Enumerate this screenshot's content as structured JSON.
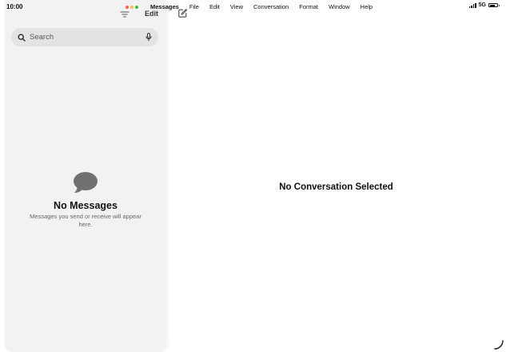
{
  "status_bar": {
    "time": "10:00",
    "network": "5G",
    "signal_icon": "signal-bars-icon",
    "battery_icon": "battery-icon"
  },
  "window_controls": {
    "close_color": "#ff5f57",
    "minimize_color": "#febc2e",
    "zoom_color": "#28c840"
  },
  "menu_bar": {
    "items": [
      "Messages",
      "File",
      "Edit",
      "View",
      "Conversation",
      "Format",
      "Window",
      "Help"
    ]
  },
  "sidebar_toolbar": {
    "filter_icon": "filter-lines-icon",
    "edit_label": "Edit",
    "compose_icon": "compose-icon"
  },
  "search": {
    "placeholder": "Search",
    "value": "",
    "icons": [
      "search-icon",
      "microphone-icon"
    ]
  },
  "empty_state": {
    "icon": "message-bubble-icon",
    "title": "No Messages",
    "subtitle": "Messages you send or receive will appear here."
  },
  "detail": {
    "placeholder": "No Conversation Selected"
  },
  "colors": {
    "sidebar_bg": "#f2f2f2",
    "search_bg": "#e3e3e3",
    "bubble": "#707070",
    "detail_bg": "#ffffff"
  }
}
